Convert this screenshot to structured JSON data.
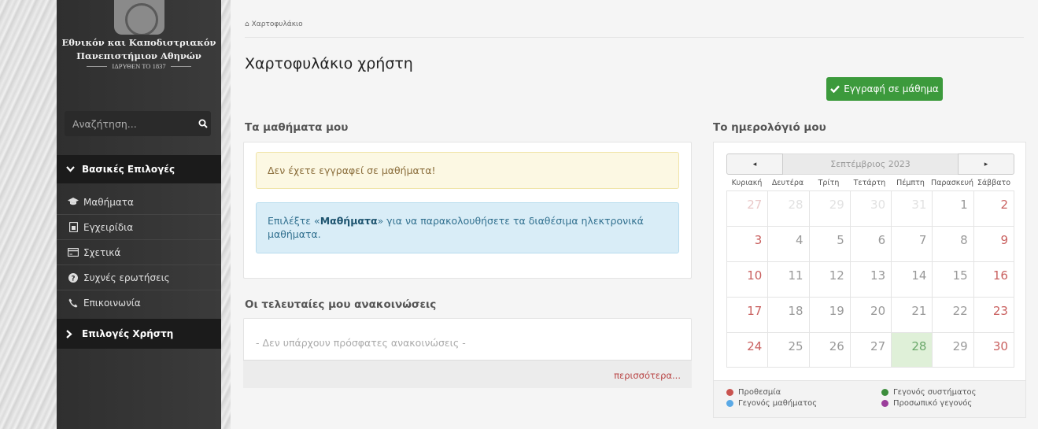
{
  "sidebar": {
    "logo_line1": "Εθνικόν και Καποδιστριακόν",
    "logo_line2": "Πανεπιστήμιον Αθηνών",
    "logo_line3": "ΙΔΡΥΘΕΝ ΤΟ 1837",
    "search_placeholder": "Αναζήτηση...",
    "section_main": "Βασικές Επιλογές",
    "items": [
      {
        "label": "Μαθήματα",
        "icon": "graduation-cap-icon"
      },
      {
        "label": "Εγχειρίδια",
        "icon": "manual-icon"
      },
      {
        "label": "Σχετικά",
        "icon": "card-icon"
      },
      {
        "label": "Συχνές ερωτήσεις",
        "icon": "question-icon"
      },
      {
        "label": "Επικοινωνία",
        "icon": "phone-icon"
      }
    ],
    "section_user": "Επιλογές Χρήστη"
  },
  "main": {
    "breadcrumb": "Χαρτοφυλάκιο",
    "page_title": "Χαρτοφυλάκιο χρήστη",
    "enroll_button": "Εγγραφή σε μάθημα",
    "my_courses_title": "Τα μαθήματα μου",
    "alert_warning": "Δεν έχετε εγγραφεί σε μαθήματα!",
    "alert_info_prefix": "Επιλέξτε «",
    "alert_info_bold": "Μαθήματα",
    "alert_info_suffix": "» για να παρακολουθήσετε τα διαθέσιμα ηλεκτρονικά μαθήματα.",
    "announcements_title": "Οι τελευταίες μου ανακοινώσεις",
    "announcements_empty": "- Δεν υπάρχουν πρόσφατες ανακοινώσεις -",
    "more_link": "περισσότερα..."
  },
  "calendar": {
    "title": "Το ημερολόγιό μου",
    "month": "Σεπτέμβριος 2023",
    "prev": "◂",
    "next": "▸",
    "weekdays": [
      "Κυριακή",
      "Δευτέρα",
      "Τρίτη",
      "Τετάρτη",
      "Πέμπτη",
      "Παρασκευή",
      "Σάββατο"
    ],
    "weeks": [
      [
        "27",
        "28",
        "29",
        "30",
        "31",
        "1",
        "2"
      ],
      [
        "3",
        "4",
        "5",
        "6",
        "7",
        "8",
        "9"
      ],
      [
        "10",
        "11",
        "12",
        "13",
        "14",
        "15",
        "16"
      ],
      [
        "17",
        "18",
        "19",
        "20",
        "21",
        "22",
        "23"
      ],
      [
        "24",
        "25",
        "26",
        "27",
        "28",
        "29",
        "30"
      ]
    ],
    "today": "28",
    "legend": [
      {
        "label": "Προθεσμία",
        "color": "#c9534f"
      },
      {
        "label": "Γεγονός συστήματος",
        "color": "#3c8d3c"
      },
      {
        "label": "Γεγονός μαθήματος",
        "color": "#5aa9e6"
      },
      {
        "label": "Προσωπικό γεγονός",
        "color": "#9b3d9b"
      }
    ]
  },
  "colors": {
    "accent_green": "#3c9a3c",
    "sidebar_dark": "#2f2f2f",
    "weekend_red": "#c9605f"
  }
}
